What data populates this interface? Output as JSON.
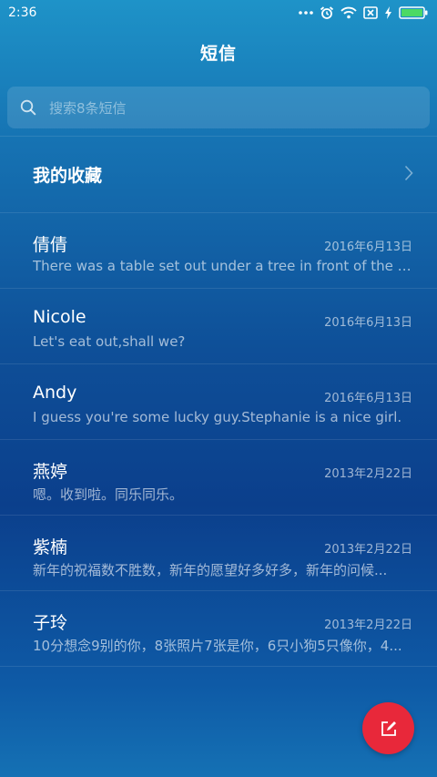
{
  "status_bar": {
    "time": "2:36",
    "icons": [
      "more-dots-icon",
      "alarm-icon",
      "wifi-icon",
      "no-sim-icon",
      "charging-icon",
      "battery-icon"
    ]
  },
  "header": {
    "title": "短信"
  },
  "search": {
    "placeholder": "搜索8条短信",
    "icon": "search-icon"
  },
  "favorites": {
    "label": "我的收藏",
    "icon": "chevron-right-icon"
  },
  "conversations": [
    {
      "name": "倩倩",
      "date": "2016年6月13日",
      "preview": "There was a table set out under a tree in front of the ho..."
    },
    {
      "name": "Nicole",
      "date": "2016年6月13日",
      "preview": "Let's eat out,shall we?"
    },
    {
      "name": "Andy",
      "date": "2016年6月13日",
      "preview": "I guess you're some lucky guy.Stephanie is a nice girl."
    },
    {
      "name": "燕婷",
      "date": "2013年2月22日",
      "preview": "嗯。收到啦。同乐同乐。"
    },
    {
      "name": "紫楠",
      "date": "2013年2月22日",
      "preview": "新年的祝福数不胜数，新年的愿望好多好多，新年的问候..."
    },
    {
      "name": "子玲",
      "date": "2013年2月22日",
      "preview": "10分想念9别的你，8张照片7张是你，6只小狗5只像你，4..."
    }
  ],
  "fab": {
    "icon": "compose-icon"
  },
  "colors": {
    "fab": "#e8283a",
    "battery": "#4cd964",
    "background_top": "#1e93c8",
    "background_mid": "#0b3f8c"
  }
}
